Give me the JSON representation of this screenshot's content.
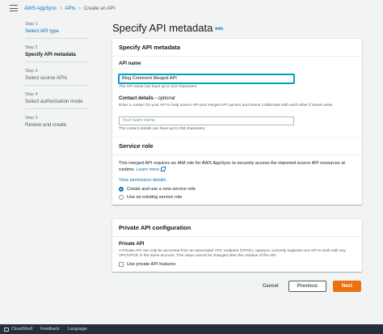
{
  "breadcrumb": {
    "items": [
      "AWS AppSync",
      "APIs",
      "Create an API"
    ]
  },
  "steps": [
    {
      "num": "Step 1",
      "name": "Select API type"
    },
    {
      "num": "Step 2",
      "name": "Specify API metadata"
    },
    {
      "num": "Step 3",
      "name": "Select source APIs"
    },
    {
      "num": "Step 4",
      "name": "Select authorization mode"
    },
    {
      "num": "Step 5",
      "name": "Review and create"
    }
  ],
  "page": {
    "title": "Specify API metadata",
    "info": "Info"
  },
  "metadata_panel": {
    "header": "Specify API metadata",
    "api_name_label": "API name",
    "api_name_value": "Blog Comment Merged API",
    "api_name_hint": "The API name can have up to 512 characters.",
    "contact_label": "Contact details",
    "contact_optional": "optional",
    "contact_desc": "Enter a contact for your API to help source API and merged API owners and teams collaborate with each other if issues arise.",
    "contact_placeholder": "Your team name",
    "contact_hint": "The contact details can have up to 256 characters."
  },
  "service_role_panel": {
    "header": "Service role",
    "desc": "This merged API requires an IAM role for AWS AppSync to securely access the imported source API resources at runtime.",
    "learn_more": "Learn more",
    "view_permission": "View permission details.",
    "option_new": "Create and use a new service role",
    "option_existing": "Use an existing service role"
  },
  "private_panel": {
    "header": "Private API configuration",
    "label": "Private API",
    "desc": "A Private API can only be accessed from an associated VPC endpoint (VPCE). AppSync currently supports one API to work with any VPC/VPCE in the same account. This value cannot be changed after the creation of the API.",
    "checkbox_label": "Use private API features"
  },
  "actions": {
    "cancel": "Cancel",
    "previous": "Previous",
    "next": "Next"
  },
  "footer": {
    "cloudshell": "CloudShell",
    "feedback": "Feedback",
    "language": "Language"
  },
  "colors": {
    "accent": "#0073bb",
    "primary_button": "#ec7211",
    "footer_bg": "#232f3e"
  }
}
